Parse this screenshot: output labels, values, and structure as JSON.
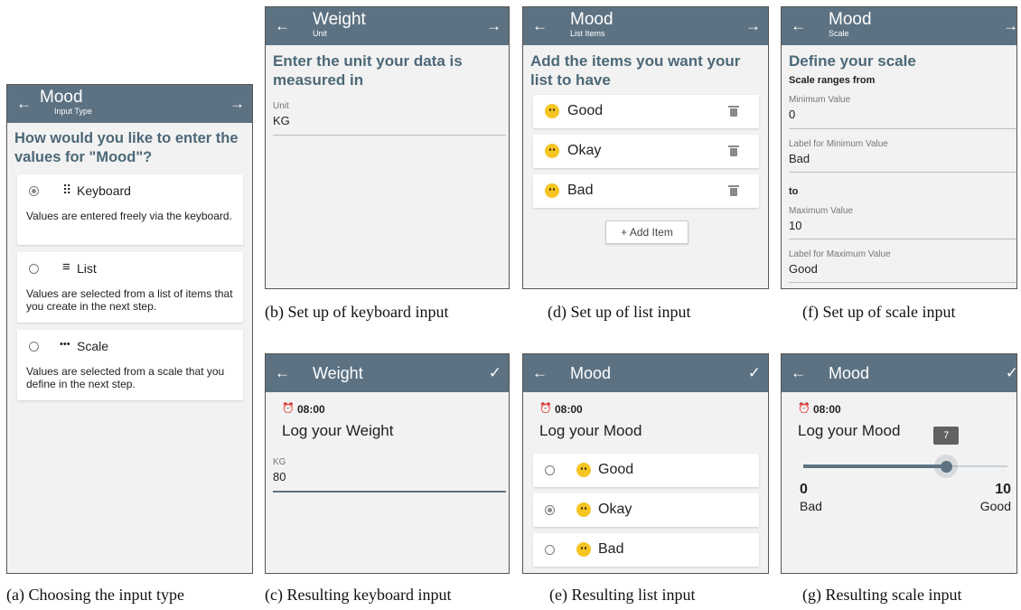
{
  "a": {
    "title": "Mood",
    "subtitle": "Input Type",
    "back": "←",
    "forward": "→",
    "heading": "How would you like to enter the values for \"Mood\"?",
    "options": [
      {
        "icon": "⠿",
        "label": "Keyboard",
        "desc": "Values are entered freely via the keyboard.",
        "selected": true
      },
      {
        "icon": "≡",
        "label": "List",
        "desc": "Values are selected from a list of items that you create in the next step.",
        "selected": false
      },
      {
        "icon": "•••",
        "label": "Scale",
        "desc": "Values are selected from a scale that you define in the next step.",
        "selected": false
      }
    ],
    "caption": "(a) Choosing the input type"
  },
  "b": {
    "title": "Weight",
    "subtitle": "Unit",
    "back": "←",
    "forward": "→",
    "heading": "Enter the unit your data is measured in",
    "field_label": "Unit",
    "field_value": "KG",
    "caption": "(b) Set up of keyboard input"
  },
  "c": {
    "title": "Weight",
    "back": "←",
    "check": "✓",
    "alarm_icon": "⏰",
    "time": "08:00",
    "prompt": "Log your Weight",
    "field_label": "KG",
    "field_value": "80",
    "caption": "(c) Resulting keyboard input"
  },
  "d": {
    "title": "Mood",
    "subtitle": "List Items",
    "back": "←",
    "forward": "→",
    "heading": "Add the items you want your list to have",
    "items": [
      "Good",
      "Okay",
      "Bad"
    ],
    "add_label": "+ Add Item",
    "caption": "(d) Set up of list input"
  },
  "e": {
    "title": "Mood",
    "back": "←",
    "check": "✓",
    "time": "08:00",
    "prompt": "Log your Mood",
    "items": [
      {
        "label": "Good",
        "selected": false
      },
      {
        "label": "Okay",
        "selected": true
      },
      {
        "label": "Bad",
        "selected": false
      }
    ],
    "caption": "(e) Resulting list input"
  },
  "f": {
    "title": "Mood",
    "subtitle": "Scale",
    "back": "←",
    "forward": "→",
    "heading": "Define your scale",
    "range_from": "Scale ranges from",
    "min_label": "Minimum Value",
    "min_value": "0",
    "min_lbl_label": "Label for Minimum Value",
    "min_lbl_value": "Bad",
    "to": "to",
    "max_label": "Maximum Value",
    "max_value": "10",
    "max_lbl_label": "Label for Maximum Value",
    "max_lbl_value": "Good",
    "caption": "(f) Set up of scale input"
  },
  "g": {
    "title": "Mood",
    "back": "←",
    "check": "✓",
    "time": "08:00",
    "prompt": "Log your Mood",
    "slider": {
      "min": 0,
      "max": 10,
      "value": 7
    },
    "tooltip": "7",
    "min_num": "0",
    "max_num": "10",
    "min_text": "Bad",
    "max_text": "Good",
    "caption": "(g) Resulting scale input"
  },
  "colors": {
    "toolbar": "#5c7282",
    "heading": "#4c6878",
    "slider": "#5c7282"
  }
}
